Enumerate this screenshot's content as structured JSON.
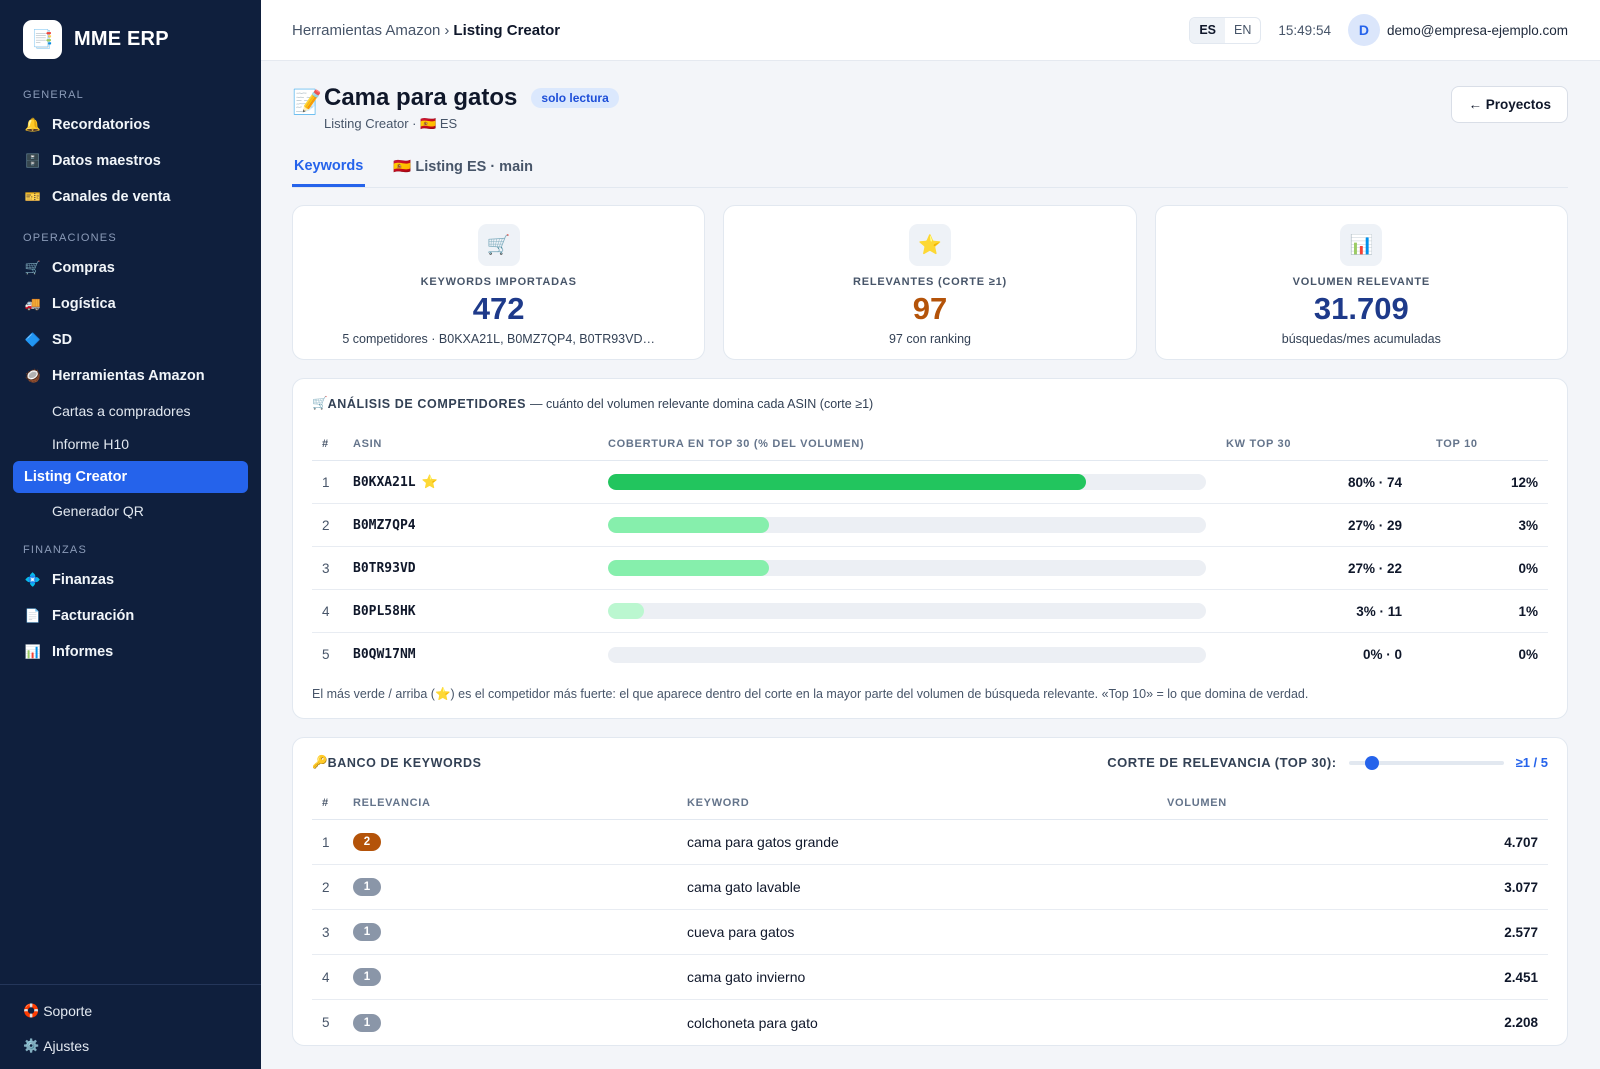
{
  "brand": {
    "logo_icon": "📑",
    "name": "MME ERP"
  },
  "sidebar": {
    "sections": {
      "general": "GENERAL",
      "operaciones": "OPERACIONES",
      "finanzas": "FINANZAS"
    },
    "items": {
      "recordatorios": {
        "icon": "🔔",
        "label": "Recordatorios"
      },
      "datos_maestros": {
        "icon": "🗄️",
        "label": "Datos maestros"
      },
      "canales": {
        "icon": "🎫",
        "label": "Canales de venta"
      },
      "compras": {
        "icon": "🛒",
        "label": "Compras"
      },
      "logistica": {
        "icon": "🚚",
        "label": "Logística"
      },
      "sd": {
        "icon": "🔷",
        "label": "SD"
      },
      "amazon": {
        "icon": "🥥",
        "label": "Herramientas Amazon"
      },
      "cartas": {
        "label": "Cartas a compradores"
      },
      "informe_h10": {
        "label": "Informe H10"
      },
      "listing_creator": {
        "label": "Listing Creator"
      },
      "generador_qr": {
        "label": "Generador QR"
      },
      "finanzas": {
        "icon": "💠",
        "label": "Finanzas"
      },
      "facturacion": {
        "icon": "📄",
        "label": "Facturación"
      },
      "informes": {
        "icon": "📊",
        "label": "Informes"
      }
    },
    "bottom": {
      "soporte": {
        "icon": "🛟",
        "label": "Soporte"
      },
      "ajustes": {
        "icon": "⚙️",
        "label": "Ajustes"
      }
    }
  },
  "topbar": {
    "breadcrumb_parent": "Herramientas Amazon",
    "breadcrumb_sep": "›",
    "breadcrumb_current": "Listing Creator",
    "lang_es": "ES",
    "lang_en": "EN",
    "time": "15:49:54",
    "avatar_initial": "D",
    "email": "demo@empresa-ejemplo.com"
  },
  "page": {
    "icon": "📝",
    "title": "Cama para gatos",
    "badge": "solo lectura",
    "subtitle": "Listing Creator · 🇪🇸 ES",
    "back_button": "← Proyectos"
  },
  "tabs": [
    {
      "label": "Keywords"
    },
    {
      "label": "🇪🇸 Listing ES · main"
    }
  ],
  "kpis": [
    {
      "icon": "🛒",
      "label": "KEYWORDS IMPORTADAS",
      "value": "472",
      "sub": "5 competidores · B0KXA21L, B0MZ7QP4, B0TR93VD…"
    },
    {
      "icon": "⭐",
      "label": "RELEVANTES (CORTE ≥1)",
      "value": "97",
      "sub": "97 con ranking"
    },
    {
      "icon": "📊",
      "label": "VOLUMEN RELEVANTE",
      "value": "31.709",
      "sub": "búsquedas/mes acumuladas"
    }
  ],
  "competitors": {
    "title_icon": "🛒",
    "title": "ANÁLISIS DE COMPETIDORES",
    "title_desc": "— cuánto del volumen relevante domina cada ASIN (corte ≥1)",
    "headers": {
      "n": "#",
      "asin": "ASIN",
      "coverage": "COBERTURA EN TOP 30 (% DEL VOLUMEN)",
      "kw": "KW TOP 30",
      "top10": "TOP 10"
    },
    "rows": [
      {
        "n": "1",
        "asin": "B0KXA21L",
        "star": "⭐",
        "coverage": 80,
        "color": "#22c55e",
        "kw": "80% · 74",
        "top10": "12%"
      },
      {
        "n": "2",
        "asin": "B0MZ7QP4",
        "star": "",
        "coverage": 27,
        "color": "#86efac",
        "kw": "27% · 29",
        "top10": "3%"
      },
      {
        "n": "3",
        "asin": "B0TR93VD",
        "star": "",
        "coverage": 27,
        "color": "#86efac",
        "kw": "27% · 22",
        "top10": "0%"
      },
      {
        "n": "4",
        "asin": "B0PL58HK",
        "star": "",
        "coverage": 6,
        "color": "#bbf7d0",
        "kw": "3% · 11",
        "top10": "1%"
      },
      {
        "n": "5",
        "asin": "B0QW17NM",
        "star": "",
        "coverage": 0,
        "color": "#bbf7d0",
        "kw": "0% · 0",
        "top10": "0%"
      }
    ],
    "note": "El más verde / arriba (⭐) es el competidor más fuerte: el que aparece dentro del corte en la mayor parte del volumen de búsqueda relevante. «Top 10» = lo que domina de verdad."
  },
  "keyword_bank": {
    "title_icon": "🔑",
    "title": "BANCO DE KEYWORDS",
    "slider_label": "CORTE DE RELEVANCIA (TOP 30):",
    "slider_level": 0.12,
    "slider_value": "≥1 / 5",
    "headers": {
      "n": "#",
      "relevance": "RELEVANCIA",
      "keyword": "KEYWORD",
      "volume": "VOLUMEN"
    },
    "rows": [
      {
        "n": "1",
        "rel": "2",
        "rel_color": "#b45309",
        "keyword": "cama para gatos grande",
        "volume": "4.707"
      },
      {
        "n": "2",
        "rel": "1",
        "rel_color": "#8a96a8",
        "keyword": "cama gato lavable",
        "volume": "3.077"
      },
      {
        "n": "3",
        "rel": "1",
        "rel_color": "#8a96a8",
        "keyword": "cueva para gatos",
        "volume": "2.577"
      },
      {
        "n": "4",
        "rel": "1",
        "rel_color": "#8a96a8",
        "keyword": "cama gato invierno",
        "volume": "2.451"
      },
      {
        "n": "5",
        "rel": "1",
        "rel_color": "#8a96a8",
        "keyword": "colchoneta para gato",
        "volume": "2.208"
      }
    ]
  }
}
